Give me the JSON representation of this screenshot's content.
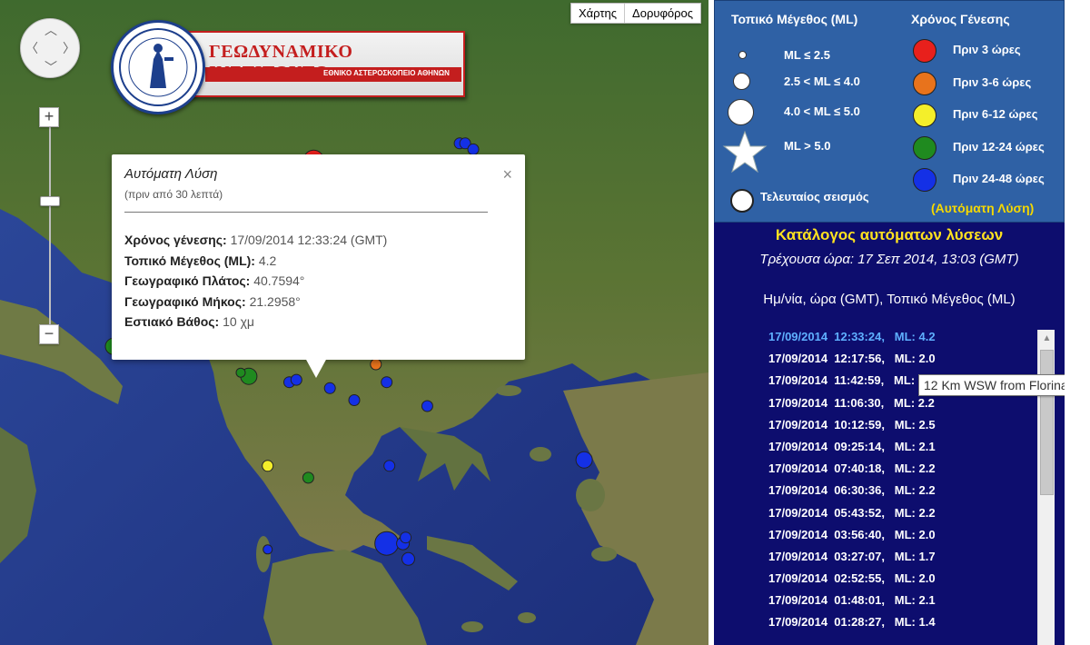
{
  "map": {
    "type_buttons": [
      "Χάρτης",
      "Δορυφόρος"
    ],
    "logo": {
      "title": "ΓΕΩΔΥΝΑΜΙΚΟ ΙΝΣΤΙΤΟΥΤΟ",
      "subtitle": "ΕΘΝΙΚΟ ΑΣΤΕΡΟΣΚΟΠΕΙΟ ΑΘΗΝΩΝ"
    },
    "zoom": {
      "in": "+",
      "out": "−",
      "level_fraction": 0.65
    },
    "popup": {
      "title": "Αυτόματη Λύση",
      "subtitle": "(πριν από 30 λεπτά)",
      "close": "×",
      "rows": [
        {
          "label": "Χρόνος γένεσης:",
          "value": "17/09/2014  12:33:24 (GMT)"
        },
        {
          "label": "Τοπικό Μέγεθος (ML):",
          "value": "4.2"
        },
        {
          "label": "Γεωγραφικό Πλάτος:",
          "value": "40.7594°"
        },
        {
          "label": "Γεωγραφικό Μήκος:",
          "value": "21.2958°"
        },
        {
          "label": "Εστιακό Βάθος:",
          "value": "10 χμ"
        }
      ]
    },
    "colors": {
      "red": "#e8201c",
      "orange": "#e8731c",
      "yellow": "#f4ef2a",
      "green": "#1f8a1f",
      "blue": "#1430e6"
    },
    "markers": [
      {
        "c": "red",
        "s": 22,
        "lon": 21.3,
        "lat": 40.76
      },
      {
        "c": "yellow",
        "s": 12,
        "lon": 21.25,
        "lat": 40.72
      },
      {
        "c": "red",
        "s": 12,
        "lon": 21.55,
        "lat": 40.55
      },
      {
        "c": "green",
        "s": 12,
        "lon": 22.4,
        "lat": 40.55
      },
      {
        "c": "red",
        "s": 10,
        "lon": 22.12,
        "lat": 40.3
      },
      {
        "c": "green",
        "s": 12,
        "lon": 22.17,
        "lat": 40.33
      },
      {
        "c": "blue",
        "s": 12,
        "lon": 23.25,
        "lat": 40.5
      },
      {
        "c": "blue",
        "s": 12,
        "lon": 23.55,
        "lat": 40.5
      },
      {
        "c": "blue",
        "s": 12,
        "lon": 24.0,
        "lat": 40.9
      },
      {
        "c": "blue",
        "s": 12,
        "lon": 24.1,
        "lat": 40.9
      },
      {
        "c": "blue",
        "s": 12,
        "lon": 24.25,
        "lat": 40.85
      },
      {
        "c": "blue",
        "s": 14,
        "lon": 23.3,
        "lat": 40.2
      },
      {
        "c": "blue",
        "s": 12,
        "lon": 23.45,
        "lat": 40.15
      },
      {
        "c": "blue",
        "s": 12,
        "lon": 24.6,
        "lat": 39.9
      },
      {
        "c": "blue",
        "s": 20,
        "lon": 22.3,
        "lat": 39.7
      },
      {
        "c": "blue",
        "s": 12,
        "lon": 21.3,
        "lat": 39.8
      },
      {
        "c": "red",
        "s": 12,
        "lon": 22.45,
        "lat": 39.4
      },
      {
        "c": "blue",
        "s": 12,
        "lon": 23.0,
        "lat": 39.6
      },
      {
        "c": "yellow",
        "s": 12,
        "lon": 20.8,
        "lat": 39.4
      },
      {
        "c": "blue",
        "s": 12,
        "lon": 21.6,
        "lat": 39.35
      },
      {
        "c": "blue",
        "s": 12,
        "lon": 21.9,
        "lat": 39.2
      },
      {
        "c": "orange",
        "s": 12,
        "lon": 22.45,
        "lat": 39.05
      },
      {
        "c": "green",
        "s": 18,
        "lon": 20.1,
        "lat": 38.95
      },
      {
        "c": "green",
        "s": 10,
        "lon": 19.95,
        "lat": 38.98
      },
      {
        "c": "blue",
        "s": 12,
        "lon": 20.85,
        "lat": 38.9
      },
      {
        "c": "blue",
        "s": 12,
        "lon": 20.98,
        "lat": 38.92
      },
      {
        "c": "blue",
        "s": 12,
        "lon": 21.6,
        "lat": 38.85
      },
      {
        "c": "blue",
        "s": 12,
        "lon": 22.05,
        "lat": 38.75
      },
      {
        "c": "blue",
        "s": 12,
        "lon": 22.65,
        "lat": 38.9
      },
      {
        "c": "blue",
        "s": 12,
        "lon": 23.4,
        "lat": 38.7
      },
      {
        "c": "blue",
        "s": 18,
        "lon": 26.3,
        "lat": 38.25
      },
      {
        "c": "green",
        "s": 18,
        "lon": 17.6,
        "lat": 39.2
      },
      {
        "c": "yellow",
        "s": 12,
        "lon": 20.45,
        "lat": 38.2
      },
      {
        "c": "green",
        "s": 12,
        "lon": 21.2,
        "lat": 38.1
      },
      {
        "c": "blue",
        "s": 12,
        "lon": 22.7,
        "lat": 38.2
      },
      {
        "c": "blue",
        "s": 26,
        "lon": 22.65,
        "lat": 37.55
      },
      {
        "c": "blue",
        "s": 14,
        "lon": 22.95,
        "lat": 37.55
      },
      {
        "c": "blue",
        "s": 14,
        "lon": 23.05,
        "lat": 37.42
      },
      {
        "c": "blue",
        "s": 12,
        "lon": 23.0,
        "lat": 37.6
      },
      {
        "c": "blue",
        "s": 10,
        "lon": 20.45,
        "lat": 37.5
      }
    ]
  },
  "legend": {
    "size_heading": "Τοπικό Μέγεθος (ML)",
    "time_heading": "Χρόνος Γένεσης",
    "sizes": [
      "ML ≤ 2.5",
      "2.5 < ML ≤ 4.0",
      "4.0 < ML ≤ 5.0",
      "ML > 5.0",
      "Τελευταίος σεισμός"
    ],
    "times": [
      {
        "label": "Πριν 3 ώρες",
        "color": "#e8201c"
      },
      {
        "label": "Πριν 3-6 ώρες",
        "color": "#e8731c"
      },
      {
        "label": "Πριν 6-12 ώρες",
        "color": "#f4ef2a"
      },
      {
        "label": "Πριν 12-24 ώρες",
        "color": "#1f8a1f"
      },
      {
        "label": "Πριν 24-48 ώρες",
        "color": "#1430e6"
      }
    ],
    "auto_note": "(Αυτόματη Λύση)"
  },
  "catalog": {
    "title": "Κατάλογος αυτόματων λύσεων",
    "current_time": "Τρέχουσα ώρα: 17 Σεπ 2014, 13:03 (GMT)",
    "header": "Ημ/νία, ώρα (GMT), Τοπικό Μέγεθος (ML)",
    "items": [
      "17/09/2014  12:33:24,   ML: 4.2",
      "17/09/2014  12:17:56,   ML: 2.0",
      "17/09/2014  11:42:59,   ML: 2.",
      "17/09/2014  11:06:30,   ML: 2.2",
      "17/09/2014  10:12:59,   ML: 2.5",
      "17/09/2014  09:25:14,   ML: 2.1",
      "17/09/2014  07:40:18,   ML: 2.2",
      "17/09/2014  06:30:36,   ML: 2.2",
      "17/09/2014  05:43:52,   ML: 2.2",
      "17/09/2014  03:56:40,   ML: 2.0",
      "17/09/2014  03:27:07,   ML: 1.7",
      "17/09/2014  02:52:55,   ML: 2.0",
      "17/09/2014  01:48:01,   ML: 2.1",
      "17/09/2014  01:28:27,   ML: 1.4"
    ],
    "tooltip": "12 Km WSW from Florina"
  }
}
